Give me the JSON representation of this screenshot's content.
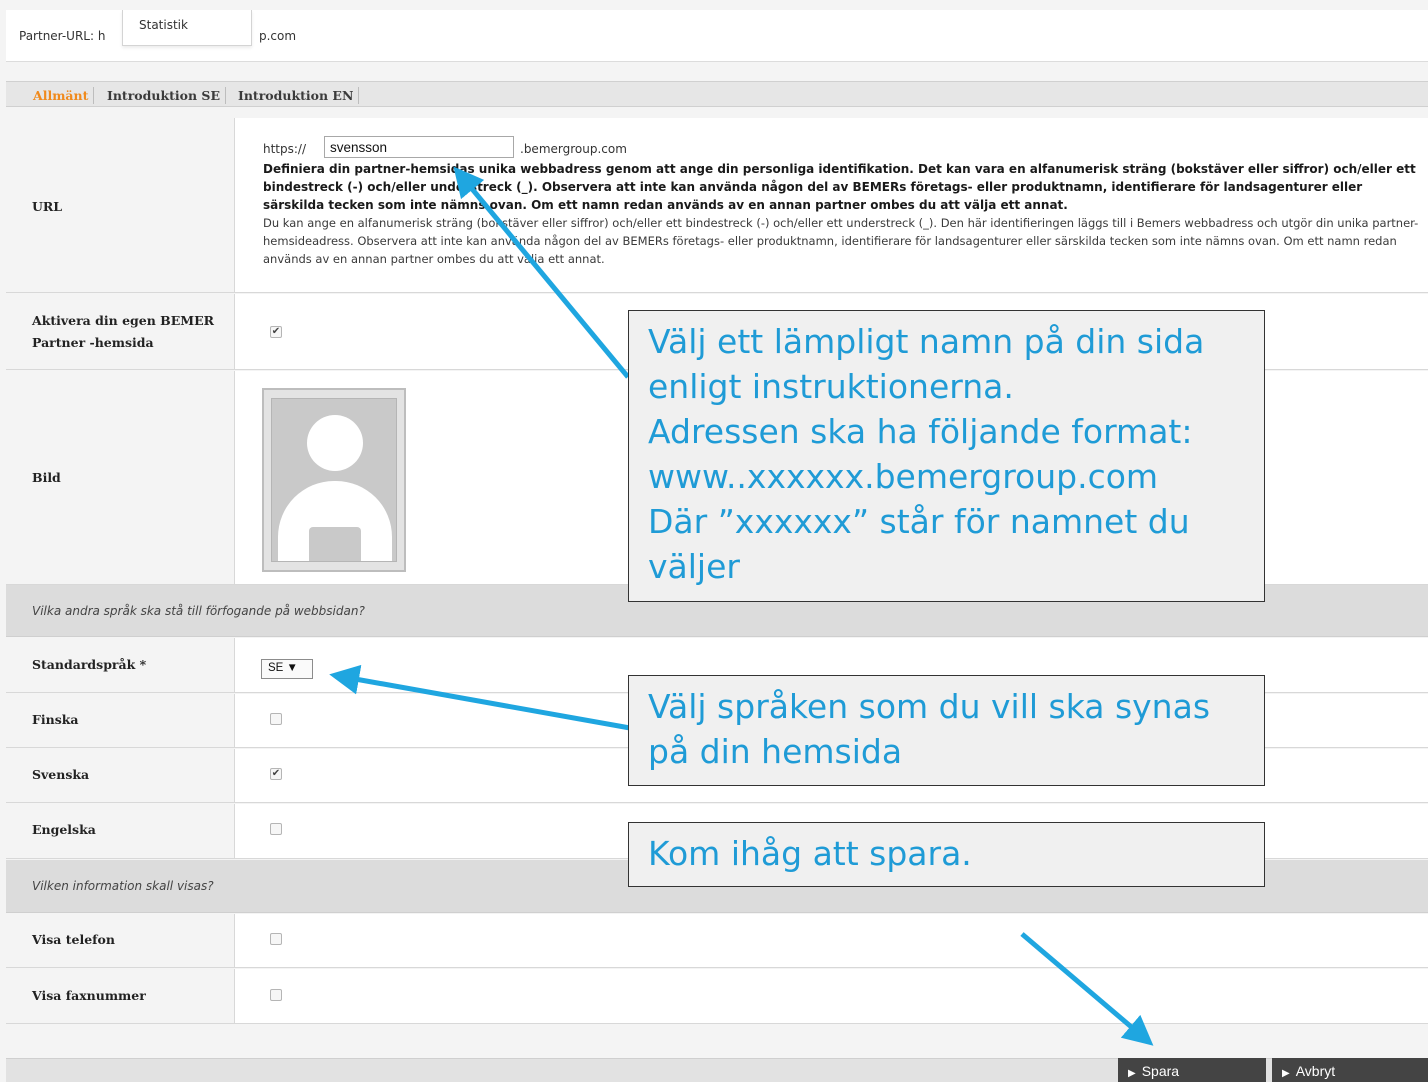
{
  "header": {
    "partner_url_prefix": "Partner-URL: h",
    "partner_url_suffix": "p.com",
    "menu_item": "Statistik"
  },
  "tabs": [
    {
      "label": "Allmänt",
      "active": true
    },
    {
      "label": "Introduktion SE",
      "active": false
    },
    {
      "label": "Introduktion EN",
      "active": false
    }
  ],
  "url_row": {
    "label": "URL",
    "prefix": "https://",
    "value": "svensson",
    "suffix": ".bemergroup.com",
    "desc_bold": "Definiera din partner-hemsidas unika webbadress genom att ange din personliga identifikation. Det kan vara en alfanumerisk sträng (bokstäver eller siffror) och/eller ett bindestreck (-) och/eller understreck (_). Observera att inte kan använda någon del av BEMERs företags- eller produktnamn, identifierare för landsagenturer eller särskilda tecken som inte nämns ovan. Om ett namn redan används av en annan partner ombes du att välja ett annat.",
    "desc_normal": "Du kan ange en alfanumerisk sträng (bokstäver eller siffror) och/eller ett bindestreck (-) och/eller ett understreck (_). Den här identifieringen läggs till i Bemers webbadress och utgör din unika partner-hemsideadress. Observera att inte kan använda någon del av BEMERs företags- eller produktnamn, identifierare för landsagenturer eller särskilda tecken som inte nämns ovan. Om ett namn redan används av en annan partner ombes du att välja ett annat."
  },
  "activate_row": {
    "label_line1": "Aktivera din egen BEMER",
    "label_line2": "Partner -hemsida",
    "checked": true,
    "mark": "✔"
  },
  "image_row": {
    "label": "Bild"
  },
  "languages_section": {
    "heading": "Vilka andra språk ska stå till förfogande på webbsidan?"
  },
  "default_language": {
    "label": "Standardspråk *",
    "selected": "SE ▼"
  },
  "lang_finska": {
    "label": "Finska",
    "checked": false
  },
  "lang_svenska": {
    "label": "Svenska",
    "checked": true,
    "mark": "✔"
  },
  "lang_engelska": {
    "label": "Engelska",
    "checked": false
  },
  "info_section": {
    "heading": "Vilken information skall visas?"
  },
  "show_phone": {
    "label": "Visa telefon",
    "checked": false
  },
  "show_fax": {
    "label": "Visa faxnummer",
    "checked": false
  },
  "buttons": {
    "save": "Spara",
    "cancel": "Avbryt",
    "tri": "▶"
  },
  "callouts": {
    "name_line1": "Välj ett lämpligt namn på din sida",
    "name_line2": "enligt instruktionerna.",
    "name_line3": "Adressen ska ha följande format:",
    "name_line4": "www..xxxxxx.bemergroup.com",
    "name_line5": "Där ”xxxxxx” står för namnet du",
    "name_line6": "väljer",
    "lang_line1": "Välj språken som du vill ska synas",
    "lang_line2": "på din hemsida",
    "save": "Kom ihåg att spara."
  },
  "colors": {
    "accent": "#f08a1c",
    "annotation": "#1f9bd6",
    "button": "#444444"
  }
}
